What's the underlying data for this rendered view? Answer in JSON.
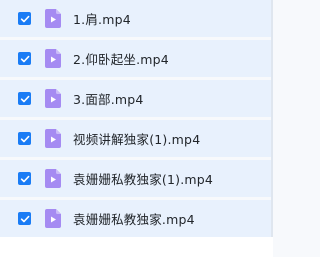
{
  "colors": {
    "selected_row_bg": "#e8f1fd",
    "checkbox_fill": "#1a7cf5",
    "video_icon_fill": "#a58bf2",
    "text": "#22262b"
  },
  "file_list": {
    "files": [
      {
        "name": "1.肩.mp4",
        "checked": true,
        "icon": "video-file-icon"
      },
      {
        "name": "2.仰卧起坐.mp4",
        "checked": true,
        "icon": "video-file-icon"
      },
      {
        "name": "3.面部.mp4",
        "checked": true,
        "icon": "video-file-icon"
      },
      {
        "name": "视频讲解独家(1).mp4",
        "checked": true,
        "icon": "video-file-icon"
      },
      {
        "name": "袁姗姗私教独家(1).mp4",
        "checked": true,
        "icon": "video-file-icon"
      },
      {
        "name": "袁姗姗私教独家.mp4",
        "checked": true,
        "icon": "video-file-icon"
      }
    ]
  }
}
